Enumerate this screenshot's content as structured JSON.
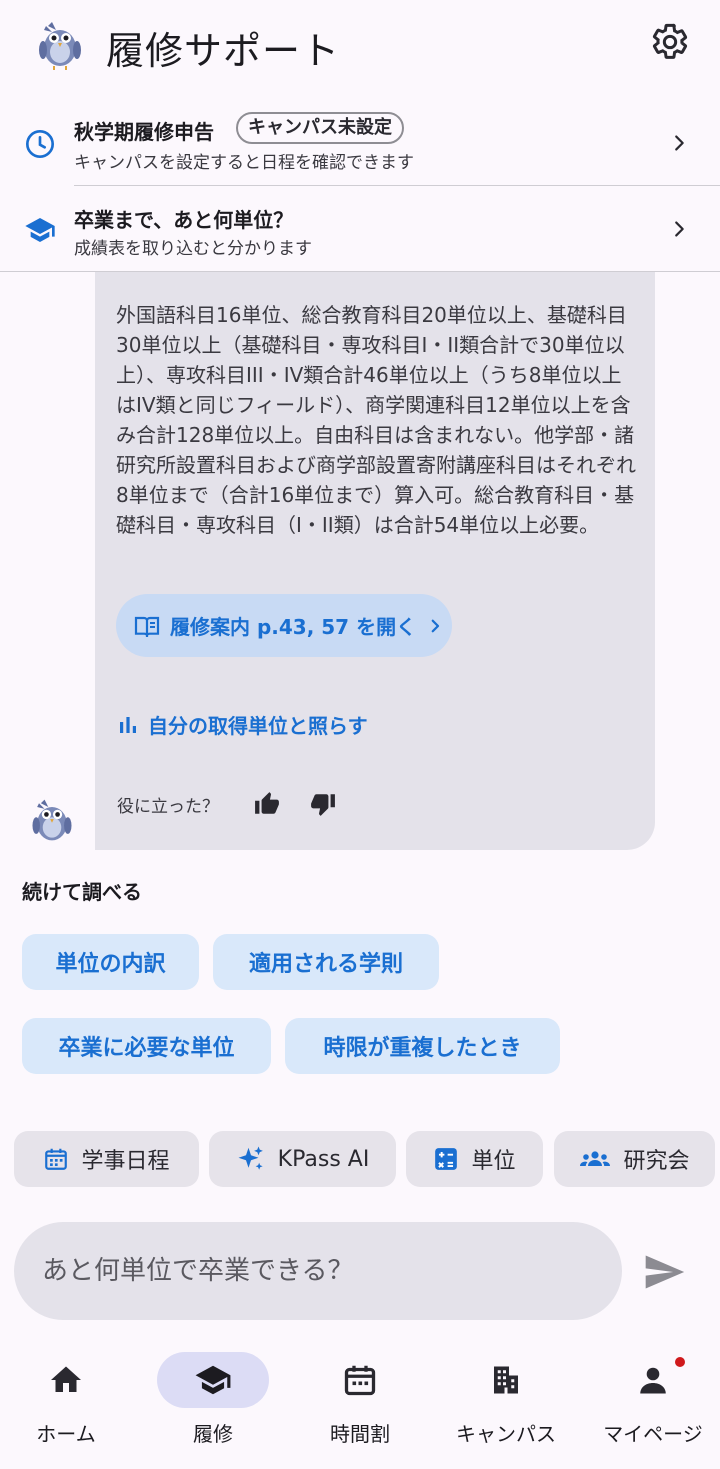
{
  "header": {
    "title": "履修サポート",
    "settings_icon": "gear-icon",
    "mascot_icon": "bird-mascot-icon"
  },
  "info_cards": [
    {
      "icon": "clock-icon",
      "title": "秋学期履修申告",
      "badge": "キャンパス未設定",
      "subtitle": "キャンパスを設定すると日程を確認できます"
    },
    {
      "icon": "graduation-cap-icon",
      "title": "卒業まで、あと何単位？",
      "subtitle": "成績表を取り込むと分かります"
    }
  ],
  "message": {
    "body": "外国語科目16単位、総合教育科目20単位以上、基礎科目30単位以上（基礎科目・専攻科目I・II類合計で30単位以上）、専攻科目III・IV類合計46単位以上（うち8単位以上はIV類と同じフィールド）、商学関連科目12単位以上を含み合計128単位以上。自由科目は含まれない。他学部・諸研究所設置科目および商学部設置寄附講座科目はそれぞれ8単位まで（合計16単位まで）算入可。総合教育科目・基礎科目・専攻科目（I・II類）は合計54単位以上必要。",
    "book_button": "履修案内 p.43, 57 を開く",
    "compare_link": "自分の取得単位と照らす",
    "feedback_label": "役に立った？"
  },
  "continue": {
    "heading": "続けて調べる",
    "suggestions": [
      "単位の内訳",
      "適用される学則",
      "卒業に必要な単位",
      "時限が重複したとき"
    ]
  },
  "quick_actions": [
    {
      "label": "学事日程",
      "icon": "calendar-icon"
    },
    {
      "label": "KPass AI",
      "icon": "sparkle-icon"
    },
    {
      "label": "単位",
      "icon": "calculator-icon"
    },
    {
      "label": "研究会",
      "icon": "group-icon"
    }
  ],
  "chat": {
    "placeholder": "あと何単位で卒業できる？",
    "send_icon": "send-icon"
  },
  "nav": [
    {
      "label": "ホーム",
      "icon": "home-icon",
      "active": false
    },
    {
      "label": "履修",
      "icon": "graduation-cap-icon",
      "active": true
    },
    {
      "label": "時間割",
      "icon": "calendar-grid-icon",
      "active": false
    },
    {
      "label": "キャンパス",
      "icon": "building-icon",
      "active": false
    },
    {
      "label": "マイページ",
      "icon": "person-icon",
      "active": false
    }
  ],
  "colors": {
    "accent": "#1a6fd1",
    "background": "#fcf8fd",
    "bubble": "#e4e2ea",
    "notification": "#d0191c"
  }
}
